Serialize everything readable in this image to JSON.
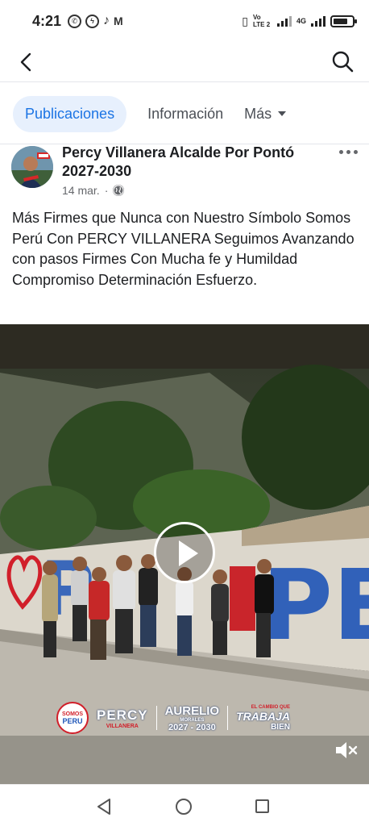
{
  "status_bar": {
    "time": "4:21",
    "network_label": "Vo LTE 2",
    "signal_label": "4G",
    "battery_level": 0.75
  },
  "top_nav": {
    "back_icon": "arrow-left-icon",
    "search_icon": "search-icon"
  },
  "tabs": [
    {
      "label": "Publicaciones",
      "active": true
    },
    {
      "label": "Información",
      "active": false
    },
    {
      "label": "Más",
      "active": false
    }
  ],
  "post": {
    "author": "Percy Villanera Alcalde Por Pontó 2027-2030",
    "date": "14 mar.",
    "separator": "·",
    "privacy_icon": "globe-icon",
    "caption": "Más Firmes que Nunca con Nuestro Símbolo Somos Perú Con PERCY VILLANERA Seguimos Avanzando con pasos Firmes Con Mucha fe y Humildad Compromiso Determinación Esfuerzo."
  },
  "video": {
    "play_icon": "play-icon",
    "mute_icon": "volume-muted-icon",
    "mural_text": "PERU",
    "logos": {
      "party_top": "SOMOS",
      "party_bottom": "PERU",
      "candidate_1": "PERCY",
      "candidate_1_sub": "VILLANERA",
      "candidate_2": "AURELIO",
      "candidate_2_sub": "MORALES",
      "years": "2027 - 2030",
      "slogan_top": "EL CAMBIO QUE",
      "slogan_mid": "TRABAJA",
      "slogan_bottom": "BIEN"
    }
  },
  "android_nav": {
    "back": "triangle-back-icon",
    "home": "circle-home-icon",
    "recent": "square-recent-icon"
  },
  "colors": {
    "accent": "#1b74e4",
    "accent_bg": "#e7f0fd",
    "text": "#1c1e21",
    "secondary": "#65676b"
  }
}
